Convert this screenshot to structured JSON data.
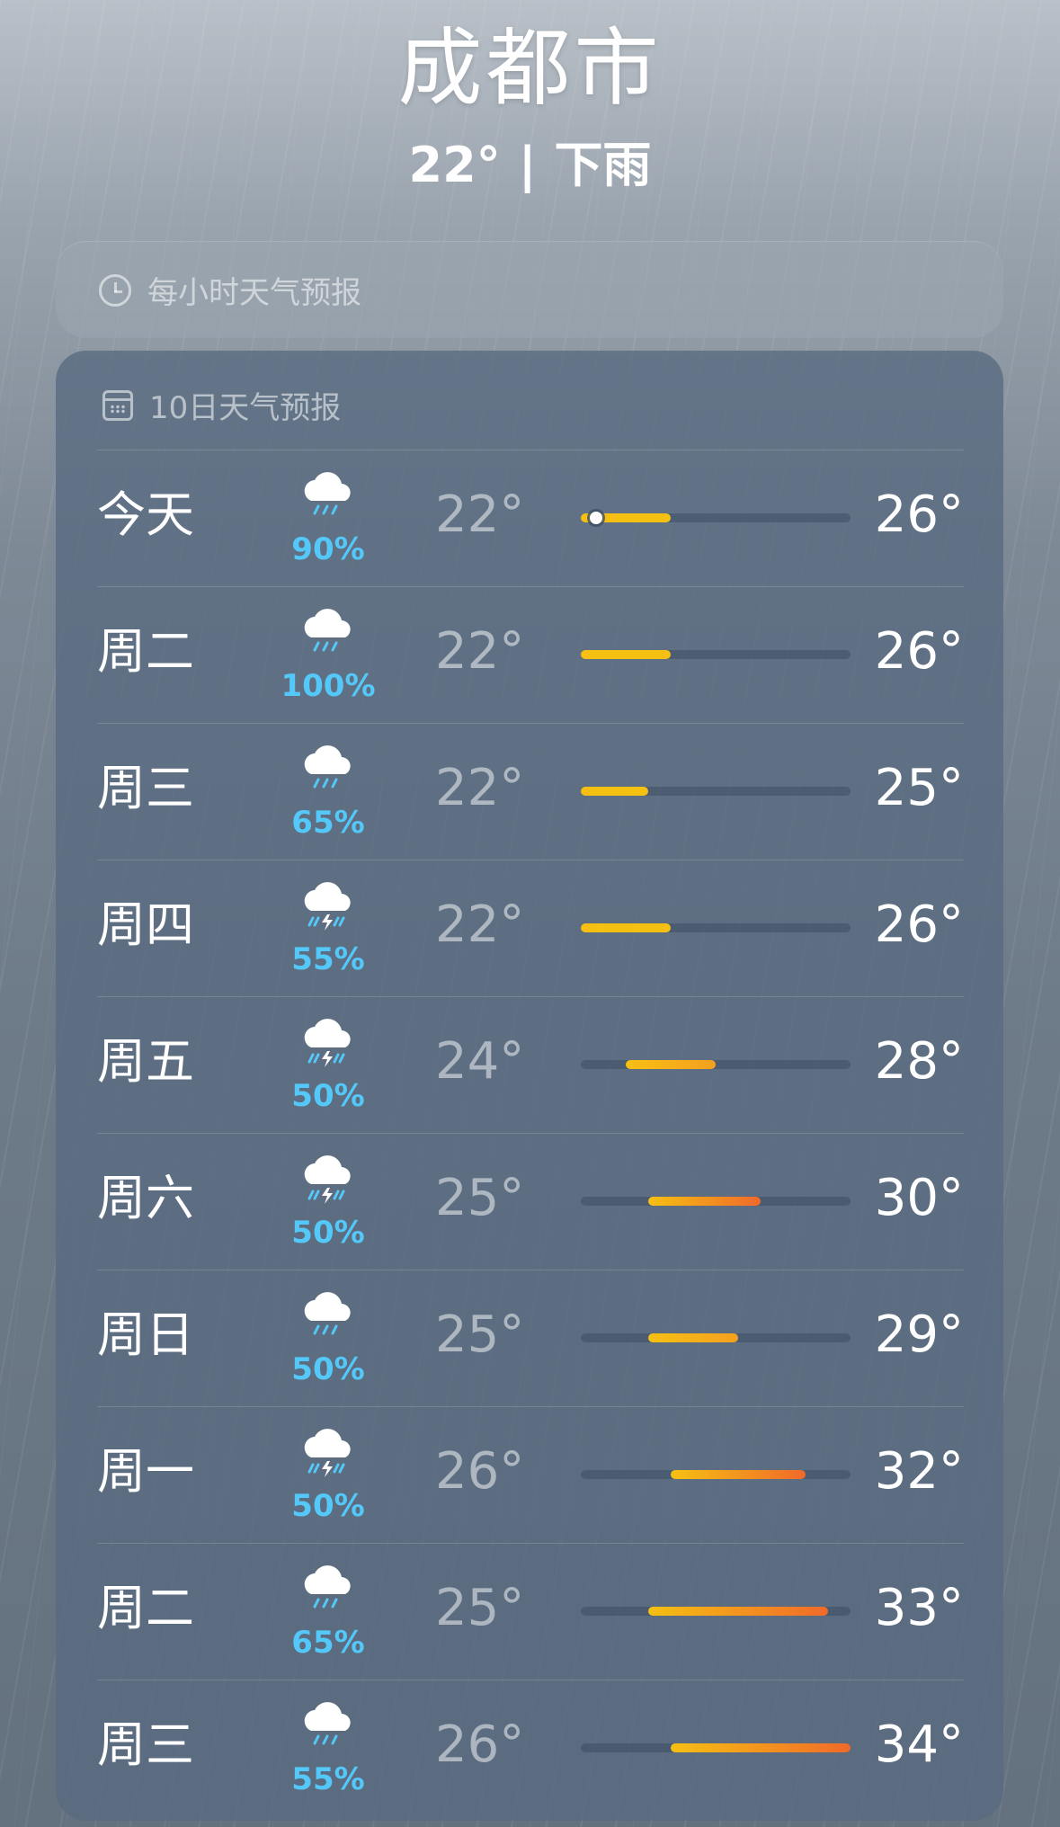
{
  "header": {
    "city": "成都市",
    "temperature": "22°",
    "separator": "|",
    "condition": "下雨"
  },
  "hourly": {
    "icon": "clock-icon",
    "title": "每小时天气预报"
  },
  "daily": {
    "icon": "calendar-icon",
    "title": "10日天气预报",
    "scale": {
      "min": 22,
      "max": 34
    },
    "current_temp": 22,
    "rows": [
      {
        "day": "今天",
        "icon": "cloud-rain-icon",
        "pop": "90%",
        "low": "22°",
        "high": "26°",
        "low_v": 22,
        "high_v": 26
      },
      {
        "day": "周二",
        "icon": "cloud-rain-icon",
        "pop": "100%",
        "low": "22°",
        "high": "26°",
        "low_v": 22,
        "high_v": 26
      },
      {
        "day": "周三",
        "icon": "cloud-rain-icon",
        "pop": "65%",
        "low": "22°",
        "high": "25°",
        "low_v": 22,
        "high_v": 25
      },
      {
        "day": "周四",
        "icon": "cloud-bolt-rain-icon",
        "pop": "55%",
        "low": "22°",
        "high": "26°",
        "low_v": 22,
        "high_v": 26
      },
      {
        "day": "周五",
        "icon": "cloud-bolt-rain-icon",
        "pop": "50%",
        "low": "24°",
        "high": "28°",
        "low_v": 24,
        "high_v": 28
      },
      {
        "day": "周六",
        "icon": "cloud-bolt-rain-icon",
        "pop": "50%",
        "low": "25°",
        "high": "30°",
        "low_v": 25,
        "high_v": 30
      },
      {
        "day": "周日",
        "icon": "cloud-rain-icon",
        "pop": "50%",
        "low": "25°",
        "high": "29°",
        "low_v": 25,
        "high_v": 29
      },
      {
        "day": "周一",
        "icon": "cloud-bolt-rain-icon",
        "pop": "50%",
        "low": "26°",
        "high": "32°",
        "low_v": 26,
        "high_v": 32
      },
      {
        "day": "周二",
        "icon": "cloud-rain-icon",
        "pop": "65%",
        "low": "25°",
        "high": "33°",
        "low_v": 25,
        "high_v": 33
      },
      {
        "day": "周三",
        "icon": "cloud-rain-icon",
        "pop": "55%",
        "low": "26°",
        "high": "34°",
        "low_v": 26,
        "high_v": 34
      }
    ]
  },
  "colors": {
    "precip": "#54c8f8",
    "bar_cool": "#f6c013",
    "bar_warm": "#f5a020",
    "bar_hot": "#f06a2a"
  }
}
